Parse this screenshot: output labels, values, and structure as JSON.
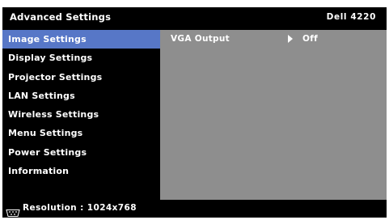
{
  "header": {
    "title": "Advanced Settings",
    "model": "Dell 4220"
  },
  "menu": {
    "items": [
      {
        "label": "Image Settings",
        "selected": true
      },
      {
        "label": "Display Settings",
        "selected": false
      },
      {
        "label": "Projector Settings",
        "selected": false
      },
      {
        "label": "LAN Settings",
        "selected": false
      },
      {
        "label": "Wireless Settings",
        "selected": false
      },
      {
        "label": "Menu Settings",
        "selected": false
      },
      {
        "label": "Power Settings",
        "selected": false
      },
      {
        "label": "Information",
        "selected": false
      }
    ]
  },
  "panel": {
    "settings": [
      {
        "label": "VGA Output",
        "icon": "play-arrow-icon",
        "value": "Off"
      }
    ]
  },
  "status": {
    "icon": "vga-input-icon",
    "label": "Resolution",
    "separator": " : ",
    "value": "1024x768"
  },
  "colors": {
    "background": "#000000",
    "selection": "#5777c7",
    "panel": "#8e8e8e",
    "text": "#ffffff"
  }
}
